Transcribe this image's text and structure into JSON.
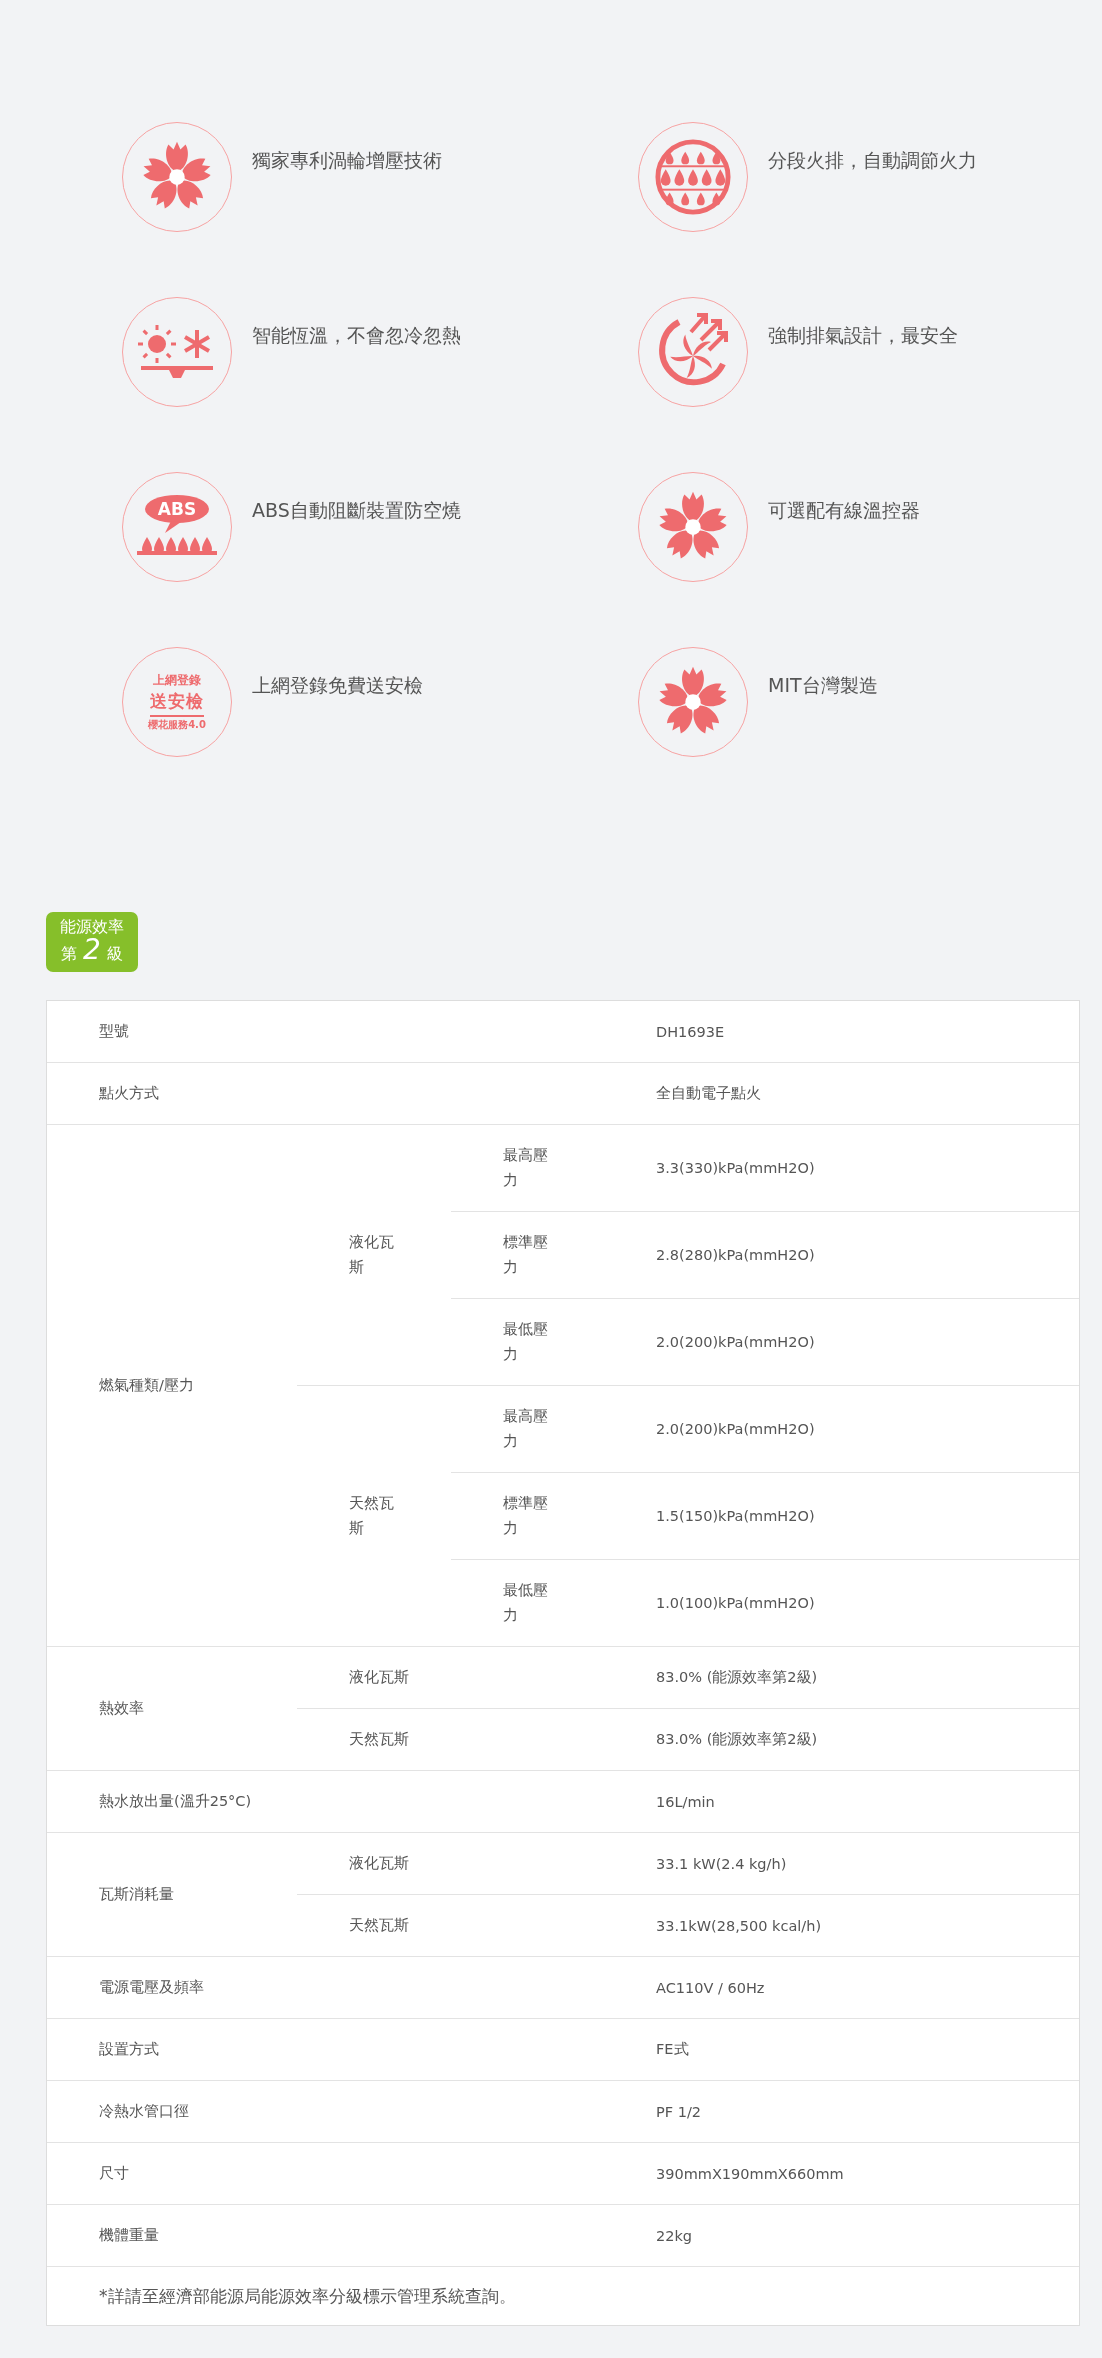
{
  "features": [
    {
      "kind": "sakura",
      "text": "獨家專利渦輪增壓技術"
    },
    {
      "kind": "drops",
      "text": "分段火排，自動調節火力"
    },
    {
      "kind": "climate",
      "text": "智能恆溫，不會忽冷忽熱"
    },
    {
      "kind": "fan",
      "text": "強制排氣設計，最安全"
    },
    {
      "kind": "burner",
      "icon_text": [
        "ABS"
      ],
      "text": "ABS自動阻斷裝置防空燒"
    },
    {
      "kind": "sakura",
      "text": "可選配有線溫控器"
    },
    {
      "kind": "stamp",
      "icon_text": [
        "上網登錄",
        "送安檢",
        "櫻花服務4.0"
      ],
      "text": "上網登錄免費送安檢"
    },
    {
      "kind": "sakura",
      "text": "MIT台灣製造"
    }
  ],
  "energy_badge": {
    "title": "能源效率",
    "prefix": "第",
    "grade": "2",
    "suffix": "級"
  },
  "spec_table": {
    "rows": [
      {
        "kind": "simple",
        "label": "型號",
        "value": "DH1693E"
      },
      {
        "kind": "simple",
        "label": "點火方式",
        "value": "全自動電子點火"
      },
      {
        "kind": "nested",
        "label": "燃氣種類/壓力",
        "groups": [
          {
            "label": "液化瓦斯",
            "items": [
              {
                "label": "最高壓力",
                "value": "3.3(330)kPa(mmH2O)"
              },
              {
                "label": "標準壓力",
                "value": "2.8(280)kPa(mmH2O)"
              },
              {
                "label": "最低壓力",
                "value": "2.0(200)kPa(mmH2O)"
              }
            ]
          },
          {
            "label": "天然瓦斯",
            "items": [
              {
                "label": "最高壓力",
                "value": "2.0(200)kPa(mmH2O)"
              },
              {
                "label": "標準壓力",
                "value": "1.5(150)kPa(mmH2O)"
              },
              {
                "label": "最低壓力",
                "value": "1.0(100)kPa(mmH2O)"
              }
            ]
          }
        ]
      },
      {
        "kind": "sub",
        "label": "熱效率",
        "items": [
          {
            "label": "液化瓦斯",
            "value": "83.0%  (能源效率第2級)"
          },
          {
            "label": "天然瓦斯",
            "value": "83.0%  (能源效率第2級)"
          }
        ]
      },
      {
        "kind": "simple",
        "label": "熱水放出量(溫升25°C)",
        "value": "16L/min"
      },
      {
        "kind": "sub",
        "label": "瓦斯消耗量",
        "items": [
          {
            "label": "液化瓦斯",
            "value": "33.1 kW(2.4 kg/h)"
          },
          {
            "label": "天然瓦斯",
            "value": "33.1kW(28,500 kcal/h)"
          }
        ]
      },
      {
        "kind": "simple",
        "label": "電源電壓及頻率",
        "value": "AC110V / 60Hz"
      },
      {
        "kind": "simple",
        "label": "設置方式",
        "value": "FE式"
      },
      {
        "kind": "simple",
        "label": "冷熱水管口徑",
        "value": "PF 1/2"
      },
      {
        "kind": "simple",
        "label": "尺寸",
        "value": "390mmX190mmX660mm"
      },
      {
        "kind": "simple",
        "label": "機體重量",
        "value": "22kg"
      }
    ],
    "footnote": "*詳請至經濟部能源局能源效率分級標示管理系統查詢。"
  }
}
